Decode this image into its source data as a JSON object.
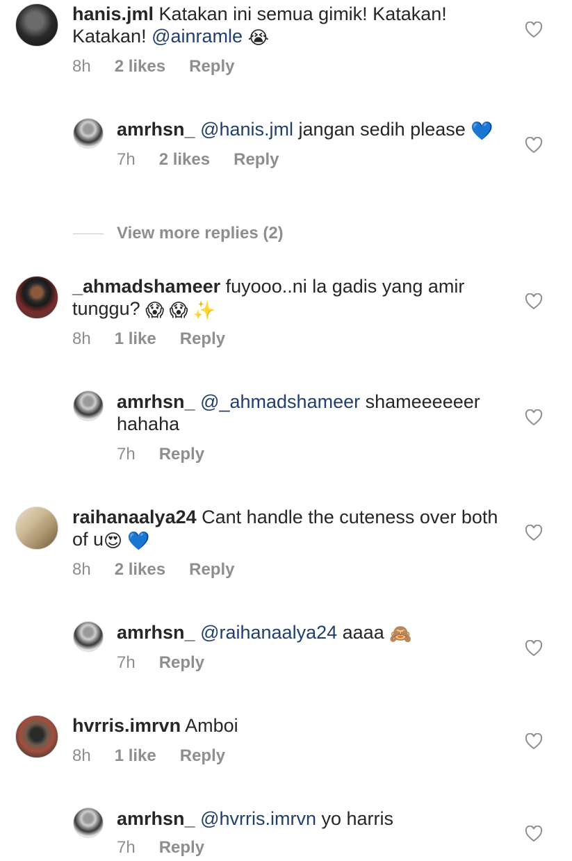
{
  "comments": [
    {
      "username": "hanis.jml",
      "text": "Katakan ini semua gimik! Katakan! Katakan!",
      "mention": "@ainramle",
      "emoji": "😭",
      "time": "8h",
      "likes": "2 likes",
      "reply_label": "Reply"
    },
    {
      "username": "amrhsn_",
      "mention": "@hanis.jml",
      "text": "jangan sedih please",
      "emoji": "💙",
      "time": "7h",
      "likes": "2 likes",
      "reply_label": "Reply"
    },
    {
      "view_more": "View more replies (2)"
    },
    {
      "username": "_ahmadshameer",
      "text": "fuyooo..ni la gadis yang amir tunggu?",
      "emoji": "😱 😱 ✨",
      "time": "8h",
      "likes": "1 like",
      "reply_label": "Reply"
    },
    {
      "username": "amrhsn_",
      "mention": "@_ahmadshameer",
      "text": "shameeeeeer hahaha",
      "time": "7h",
      "reply_label": "Reply"
    },
    {
      "username": "raihanaalya24",
      "text": "Cant handle the cuteness over both of u",
      "emoji": "😍 💙",
      "time": "8h",
      "likes": "2 likes",
      "reply_label": "Reply"
    },
    {
      "username": "amrhsn_",
      "mention": "@raihanaalya24",
      "text": "aaaa",
      "emoji": "🙈",
      "time": "7h",
      "reply_label": "Reply"
    },
    {
      "username": "hvrris.imrvn",
      "text": "Amboi",
      "time": "8h",
      "likes": "1 like",
      "reply_label": "Reply"
    },
    {
      "username": "amrhsn_",
      "mention": "@hvrris.imrvn",
      "text": "yo harris",
      "time": "7h",
      "reply_label": "Reply"
    }
  ],
  "colors": {
    "mention": "#1f3f6e",
    "meta": "#8e8e8e",
    "text": "#262626"
  },
  "icons": [
    "heart-outline-icon",
    "avatar-photo"
  ]
}
